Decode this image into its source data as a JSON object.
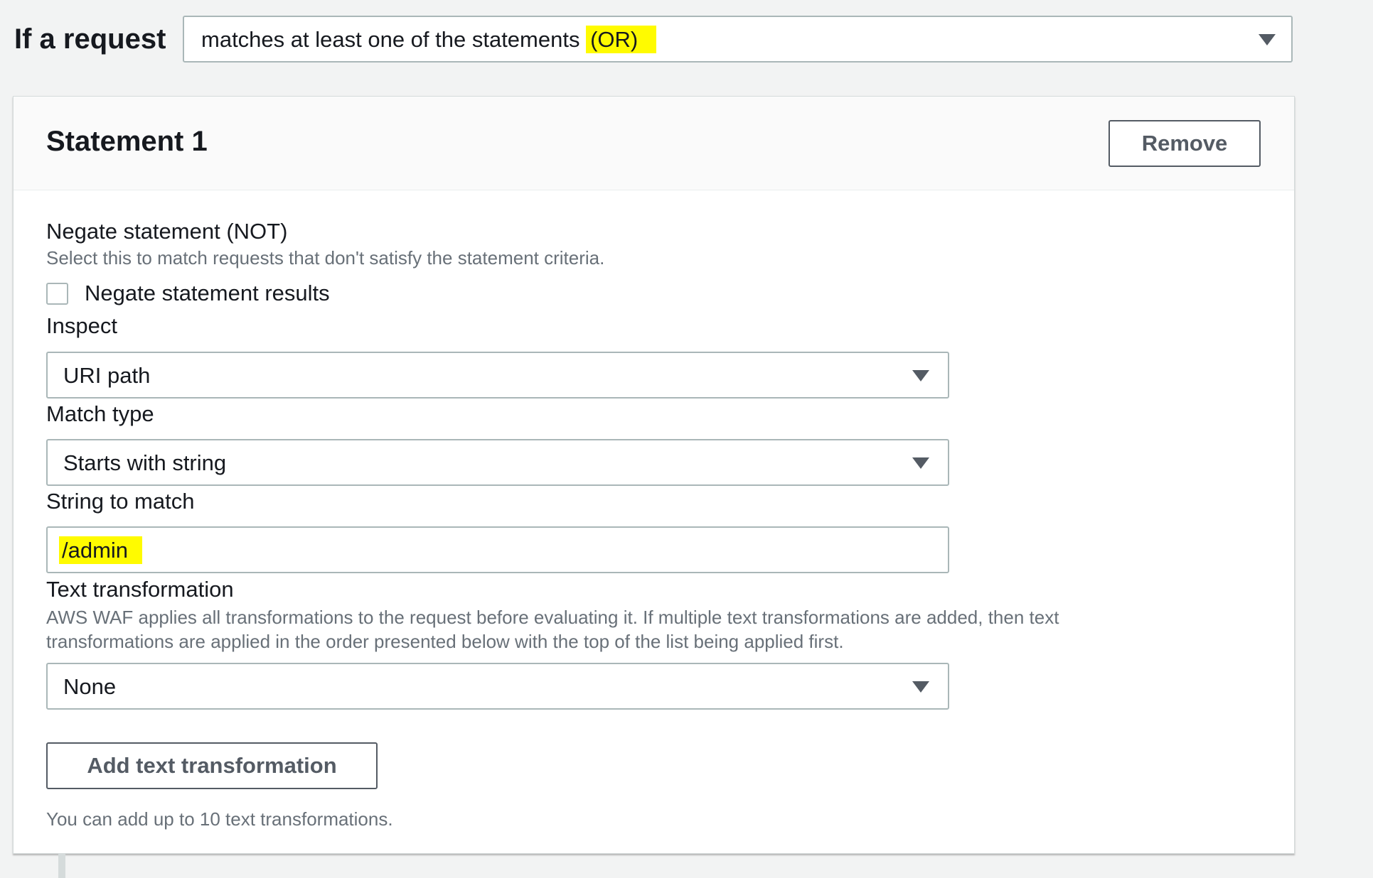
{
  "request": {
    "label": "If a request",
    "select_value_prefix": "matches at least one of the statements ",
    "select_value_highlight": "(OR)"
  },
  "statement": {
    "title": "Statement 1",
    "remove_label": "Remove",
    "negate": {
      "label": "Negate statement (NOT)",
      "description": "Select this to match requests that don't satisfy the statement criteria.",
      "checkbox_label": "Negate statement results",
      "checked": false
    },
    "inspect": {
      "label": "Inspect",
      "value": "URI path"
    },
    "match_type": {
      "label": "Match type",
      "value": "Starts with string"
    },
    "string_to_match": {
      "label": "String to match",
      "value": "/admin"
    },
    "text_transformation": {
      "label": "Text transformation",
      "description_line1": "AWS WAF applies all transformations to the request before evaluating it. If multiple text transformations are added, then text",
      "description_line2": "transformations are applied in the order presented below with the top of the list being applied first.",
      "value": "None",
      "add_label": "Add text transformation",
      "hint": "You can add up to 10 text transformations."
    }
  },
  "colors": {
    "highlight": "#fffb00",
    "page_bg": "#f2f3f3",
    "border": "#aab7b8",
    "text_secondary": "#687078"
  },
  "icons": {
    "dropdown": "caret-down-icon",
    "checkbox": "checkbox-unchecked-icon"
  }
}
